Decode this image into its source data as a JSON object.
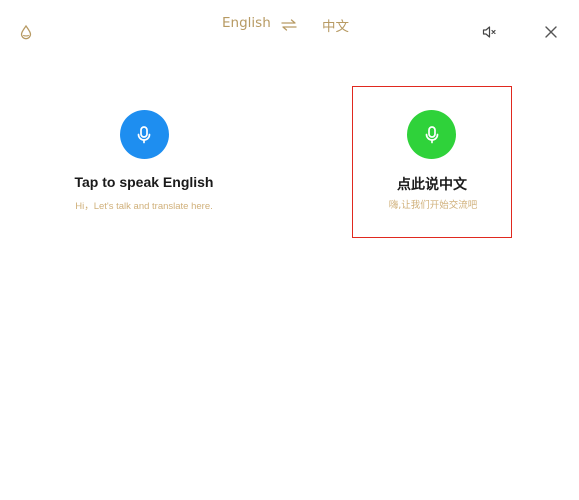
{
  "header": {
    "source_language": "English",
    "target_language": "中文",
    "icons": {
      "theme": "droplet-icon",
      "swap": "swap-arrows-icon",
      "mute": "speaker-mute-icon",
      "close": "close-icon"
    },
    "accent_color": "#b79a63"
  },
  "panels": [
    {
      "title": "Tap to speak English",
      "subtitle": "Hi，Let's talk and translate here.",
      "mic_color": "#1e8ef0",
      "icon": "microphone-icon"
    },
    {
      "title": "点此说中文",
      "subtitle": "嗨,让我们开始交流吧",
      "mic_color": "#2fd23a",
      "icon": "microphone-icon",
      "highlight_color": "#e0291f"
    }
  ]
}
